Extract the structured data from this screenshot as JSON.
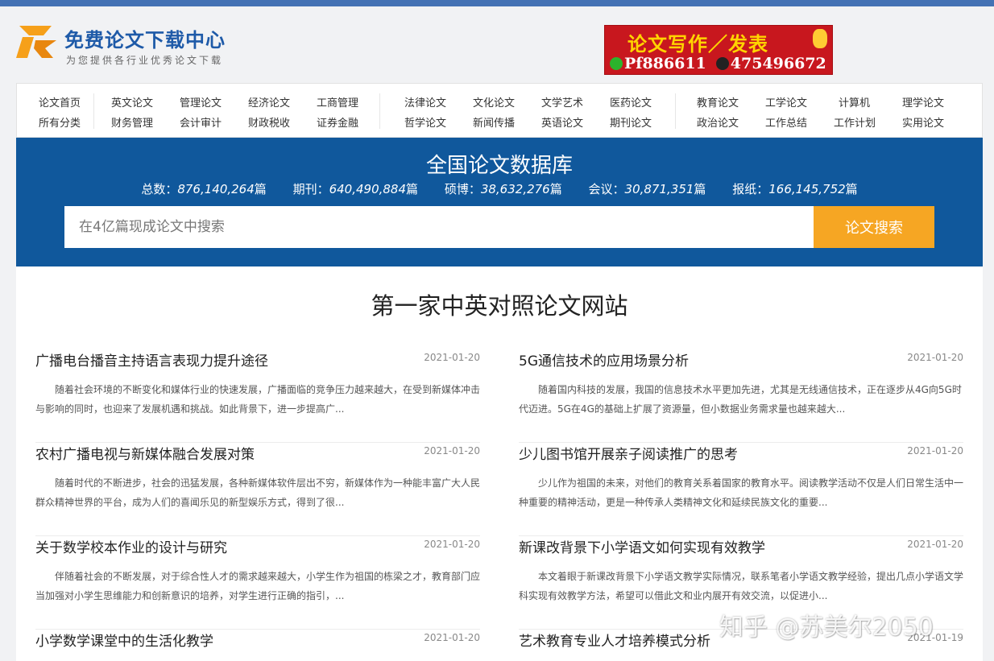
{
  "header": {
    "site_name": "免费论文下载中心",
    "slogan": "为您提供各行业优秀论文下载",
    "banner_line1": "论文写作／发表",
    "banner_wechat": "Pf886611",
    "banner_qq": "475496672"
  },
  "nav": {
    "row1": [
      "论文首页",
      "英文论文",
      "管理论文",
      "经济论文",
      "工商管理",
      "法律论文",
      "文化论文",
      "文学艺术",
      "医药论文",
      "教育论文",
      "工学论文",
      "计算机",
      "理学论文"
    ],
    "row2": [
      "所有分类",
      "财务管理",
      "会计审计",
      "财政税收",
      "证券金融",
      "哲学论文",
      "新闻传播",
      "英语论文",
      "期刊论文",
      "政治论文",
      "工作总结",
      "工作计划",
      "实用论文"
    ]
  },
  "database": {
    "title": "全国论文数据库",
    "stats": [
      {
        "label": "总数：",
        "value": "876,140,264",
        "unit": "篇"
      },
      {
        "label": "期刊：",
        "value": "640,490,884",
        "unit": "篇"
      },
      {
        "label": "硕博：",
        "value": "38,632,276",
        "unit": "篇"
      },
      {
        "label": "会议：",
        "value": "30,871,351",
        "unit": "篇"
      },
      {
        "label": "报纸：",
        "value": "166,145,752",
        "unit": "篇"
      }
    ],
    "search_placeholder": "在4亿篇现成论文中搜索",
    "search_button": "论文搜索"
  },
  "section_title": "第一家中英对照论文网站",
  "articles": [
    {
      "title": "广播电台播音主持语言表现力提升途径",
      "date": "2021-01-20",
      "summary": "随着社会环境的不断变化和媒体行业的快速发展，广播面临的竞争压力越来越大，在受到新媒体冲击与影响的同时，也迎来了发展机遇和挑战。如此背景下，进一步提高广..."
    },
    {
      "title": "5G通信技术的应用场景分析",
      "date": "2021-01-20",
      "summary": "随着国内科技的发展，我国的信息技术水平更加先进，尤其是无线通信技术，正在逐步从4G向5G时代迈进。5G在4G的基础上扩展了资源量，但小数据业务需求量也越来越大..."
    },
    {
      "title": "农村广播电视与新媒体融合发展对策",
      "date": "2021-01-20",
      "summary": "随着时代的不断进步，社会的迅猛发展，各种新媒体软件层出不穷，新媒体作为一种能丰富广大人民群众精神世界的平台，成为人们的喜闻乐见的新型娱乐方式，得到了很..."
    },
    {
      "title": "少儿图书馆开展亲子阅读推广的思考",
      "date": "2021-01-20",
      "summary": "少儿作为祖国的未来，对他们的教育关系着国家的教育水平。阅读教学活动不仅是人们日常生活中一种重要的精神活动，更是一种传承人类精神文化和延续民族文化的重要..."
    },
    {
      "title": "关于数学校本作业的设计与研究",
      "date": "2021-01-20",
      "summary": "伴随着社会的不断发展，对于综合性人才的需求越来越大，小学生作为祖国的栋梁之才，教育部门应当加强对小学生思维能力和创新意识的培养，对学生进行正确的指引，..."
    },
    {
      "title": "新课改背景下小学语文如何实现有效教学",
      "date": "2021-01-20",
      "summary": "本文着眼于新课改背景下小学语文教学实际情况，联系笔者小学语文教学经验，提出几点小学语文学科实现有效教学方法，希望可以借此文和业内展开有效交流，以促进小..."
    },
    {
      "title": "小学数学课堂中的生活化教学",
      "date": "2021-01-20",
      "summary": ""
    },
    {
      "title": "艺术教育专业人才培养模式分析",
      "date": "2021-01-19",
      "summary": ""
    }
  ],
  "watermark": "知乎 @苏美尔2050"
}
